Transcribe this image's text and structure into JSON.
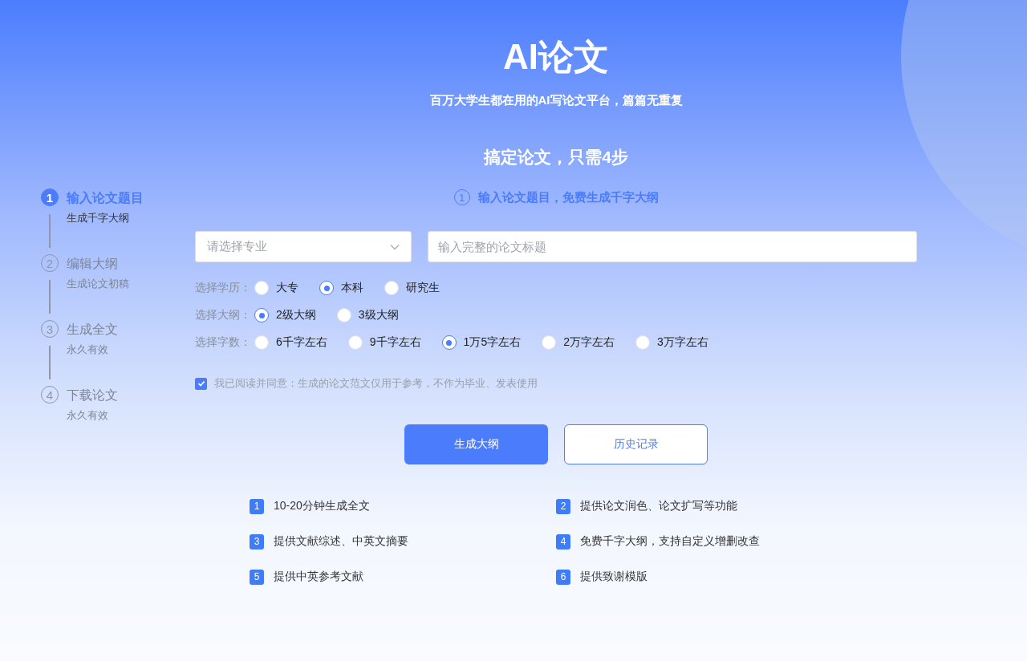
{
  "header": {
    "title": "AI论文",
    "subtitle": "百万大学生都在用的AI写论文平台，篇篇无重复"
  },
  "steps_heading": "搞定论文，只需4步",
  "steps": [
    {
      "number": "1",
      "title": "输入论文题目",
      "subtitle": "生成千字大纲",
      "selected": true
    },
    {
      "number": "2",
      "title": "编辑大纲",
      "subtitle": "生成论文初稿",
      "selected": false
    },
    {
      "number": "3",
      "title": "生成全文",
      "subtitle": "永久有效",
      "selected": false
    },
    {
      "number": "4",
      "title": "下载论文",
      "subtitle": "永久有效",
      "selected": false
    }
  ],
  "current_step": {
    "number": "1",
    "text": "输入论文题目，免费生成千字大纲"
  },
  "major_select": {
    "placeholder": "请选择专业"
  },
  "title_field": {
    "placeholder": "输入完整的论文标题"
  },
  "option_groups": [
    {
      "label": "选择学历：",
      "options": [
        {
          "label": "大专",
          "selected": false
        },
        {
          "label": "本科",
          "selected": true
        },
        {
          "label": "研究生",
          "selected": false
        }
      ]
    },
    {
      "label": "选择大纲：",
      "options": [
        {
          "label": "2级大纲",
          "selected": true
        },
        {
          "label": "3级大纲",
          "selected": false
        }
      ]
    },
    {
      "label": "选择字数：",
      "options": [
        {
          "label": "6千字左右",
          "selected": false
        },
        {
          "label": "9千字左右",
          "selected": false
        },
        {
          "label": "1万5字左右",
          "selected": true
        },
        {
          "label": "2万字左右",
          "selected": false
        },
        {
          "label": "3万字左右",
          "selected": false
        }
      ]
    }
  ],
  "agreement": {
    "checked": true,
    "text": "我已阅读并同意：生成的论文范文仅用于参考，不作为毕业、发表使用"
  },
  "buttons": [
    {
      "label": "生成大纲",
      "kind": "primary"
    },
    {
      "label": "历史记录",
      "kind": "outline"
    }
  ],
  "features": [
    {
      "number": "1",
      "text": "10-20分钟生成全文"
    },
    {
      "number": "2",
      "text": "提供论文润色、论文扩写等功能"
    },
    {
      "number": "3",
      "text": "提供文献综述、中英文摘要"
    },
    {
      "number": "4",
      "text": "免费千字大纲，支持自定义增删改查"
    },
    {
      "number": "5",
      "text": "提供中英参考文献"
    },
    {
      "number": "6",
      "text": "提供致谢模版"
    }
  ]
}
